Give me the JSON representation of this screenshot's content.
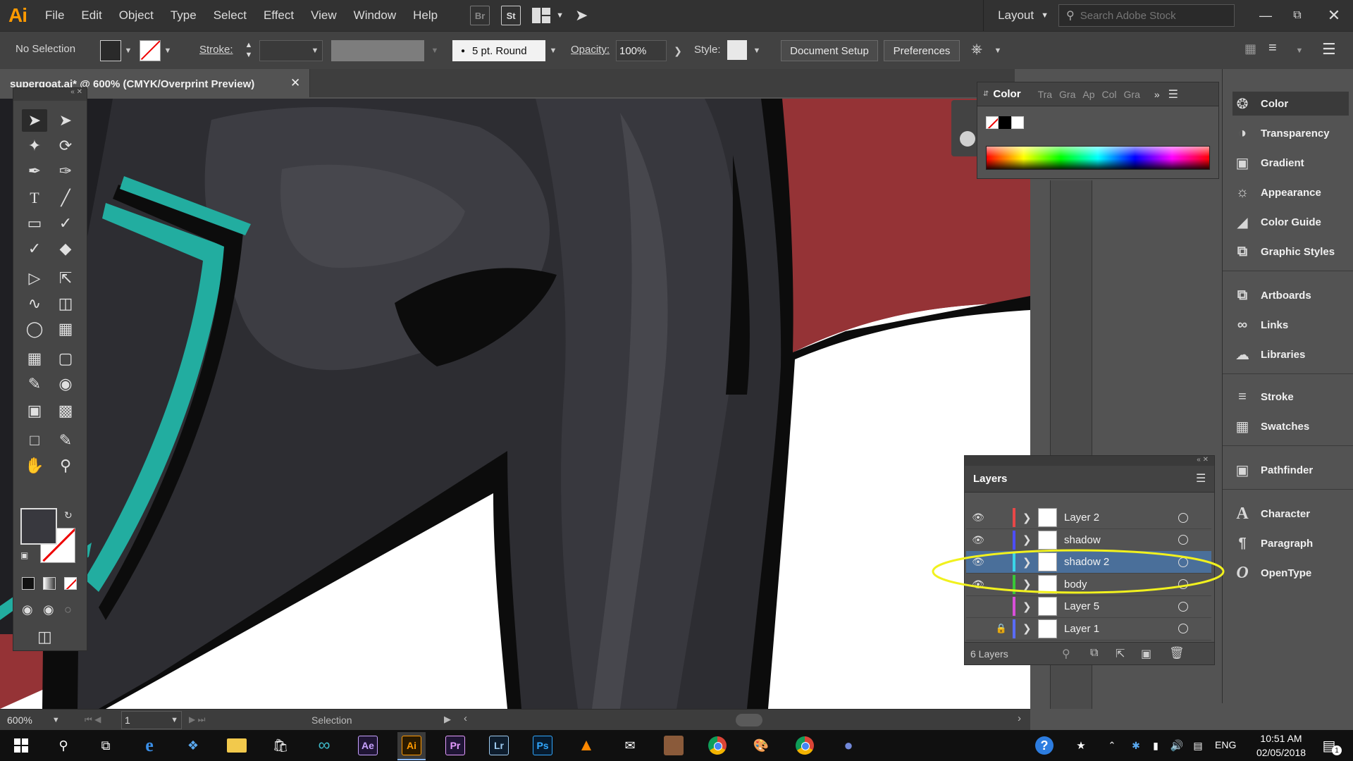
{
  "app": {
    "logo": "Ai"
  },
  "menu": [
    "File",
    "Edit",
    "Object",
    "Type",
    "Select",
    "Effect",
    "View",
    "Window",
    "Help"
  ],
  "menubar_buttons": {
    "br": "Br",
    "st": "St"
  },
  "workspace": {
    "label": "Layout"
  },
  "search": {
    "placeholder": "Search Adobe Stock"
  },
  "control_bar": {
    "selection_label": "No Selection",
    "stroke_label": "Stroke:",
    "brush_label": "5 pt. Round",
    "opacity_label": "Opacity:",
    "opacity_value": "100%",
    "style_label": "Style:",
    "document_setup": "Document Setup",
    "preferences": "Preferences"
  },
  "document": {
    "tab_title": "supergoat.ai* @ 600% (CMYK/Overprint Preview)"
  },
  "color_panel": {
    "tabs": [
      "Color",
      "Tra",
      "Gra",
      "Ap",
      "Col",
      "Gra"
    ]
  },
  "dock": {
    "group1": [
      "Color",
      "Transparency",
      "Gradient",
      "Appearance",
      "Color Guide",
      "Graphic Styles"
    ],
    "group2": [
      "Artboards",
      "Links",
      "Libraries"
    ],
    "group3": [
      "Stroke",
      "Swatches"
    ],
    "group4": [
      "Pathfinder"
    ],
    "group5": [
      "Character",
      "Paragraph",
      "OpenType"
    ]
  },
  "layers_panel": {
    "title": "Layers",
    "layers": [
      {
        "name": "Layer 2",
        "visible": true,
        "locked": false,
        "color": "#e84848"
      },
      {
        "name": "shadow",
        "visible": true,
        "locked": false,
        "color": "#4d4dff"
      },
      {
        "name": "shadow 2",
        "visible": true,
        "locked": false,
        "color": "#3ad6e8",
        "selected": true
      },
      {
        "name": "body",
        "visible": true,
        "locked": false,
        "color": "#38c838"
      },
      {
        "name": "Layer 5",
        "visible": false,
        "locked": false,
        "color": "#d84fd8"
      },
      {
        "name": "Layer 1",
        "visible": false,
        "locked": true,
        "color": "#5a6cff"
      }
    ],
    "footer": "6 Layers"
  },
  "status_bar": {
    "zoom": "600%",
    "page": "1",
    "tool": "Selection"
  },
  "taskbar": {
    "apps": [
      "Ae",
      "Ai",
      "Pr",
      "Lr",
      "Ps"
    ],
    "language": "ENG",
    "time": "10:51 AM",
    "date": "02/05/2018",
    "notification_count": "1"
  },
  "colors": {
    "artboard_red": "#953336",
    "goat_dark": "#2d2d32",
    "goat_mid": "#38383e",
    "goat_light": "#47474d",
    "stripe_teal": "#22ada0",
    "outline": "#0c0c0c",
    "selected_layer": "#4a6f9a",
    "highlight_ellipse": "#f1f11e"
  }
}
